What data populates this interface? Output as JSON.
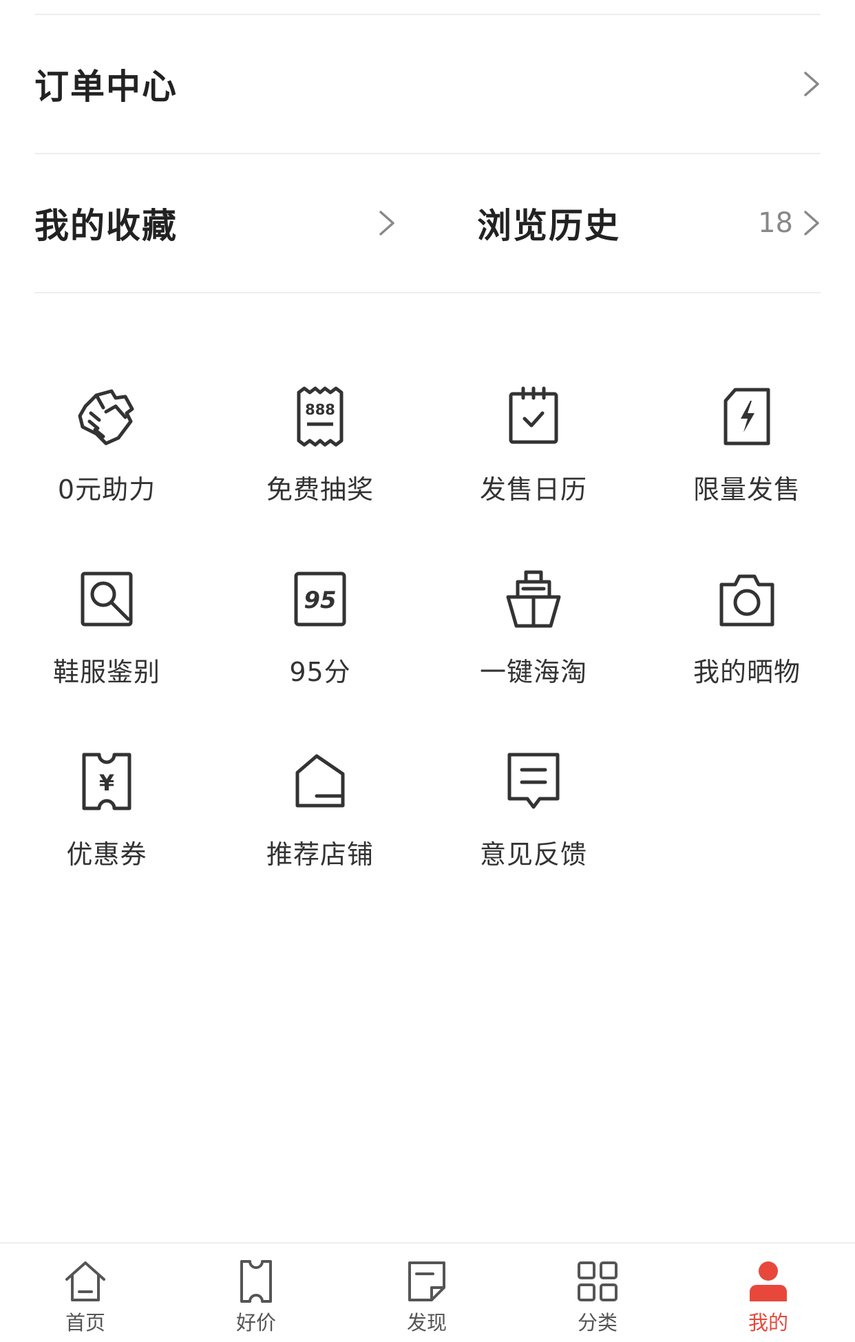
{
  "order_center": {
    "title": "订单中心"
  },
  "favorites": {
    "title": "我的收藏"
  },
  "history": {
    "title": "浏览历史",
    "count": "18"
  },
  "services": [
    {
      "label": "0元助力",
      "icon": "handshake-icon"
    },
    {
      "label": "免费抽奖",
      "icon": "lottery-ticket-icon"
    },
    {
      "label": "发售日历",
      "icon": "calendar-check-icon"
    },
    {
      "label": "限量发售",
      "icon": "lightning-icon"
    },
    {
      "label": "鞋服鉴别",
      "icon": "magnifier-icon"
    },
    {
      "label": "95分",
      "icon": "95-badge-icon"
    },
    {
      "label": "一键海淘",
      "icon": "ship-icon"
    },
    {
      "label": "我的晒物",
      "icon": "camera-icon"
    },
    {
      "label": "优惠券",
      "icon": "coupon-yen-icon"
    },
    {
      "label": "推荐店铺",
      "icon": "store-icon"
    },
    {
      "label": "意见反馈",
      "icon": "feedback-icon"
    }
  ],
  "tabbar": {
    "active_color": "#e8483c",
    "items": [
      {
        "label": "首页",
        "icon": "home-icon"
      },
      {
        "label": "好价",
        "icon": "price-tag-icon"
      },
      {
        "label": "发现",
        "icon": "discover-note-icon"
      },
      {
        "label": "分类",
        "icon": "category-grid-icon"
      },
      {
        "label": "我的",
        "icon": "profile-icon",
        "active": true
      }
    ]
  }
}
